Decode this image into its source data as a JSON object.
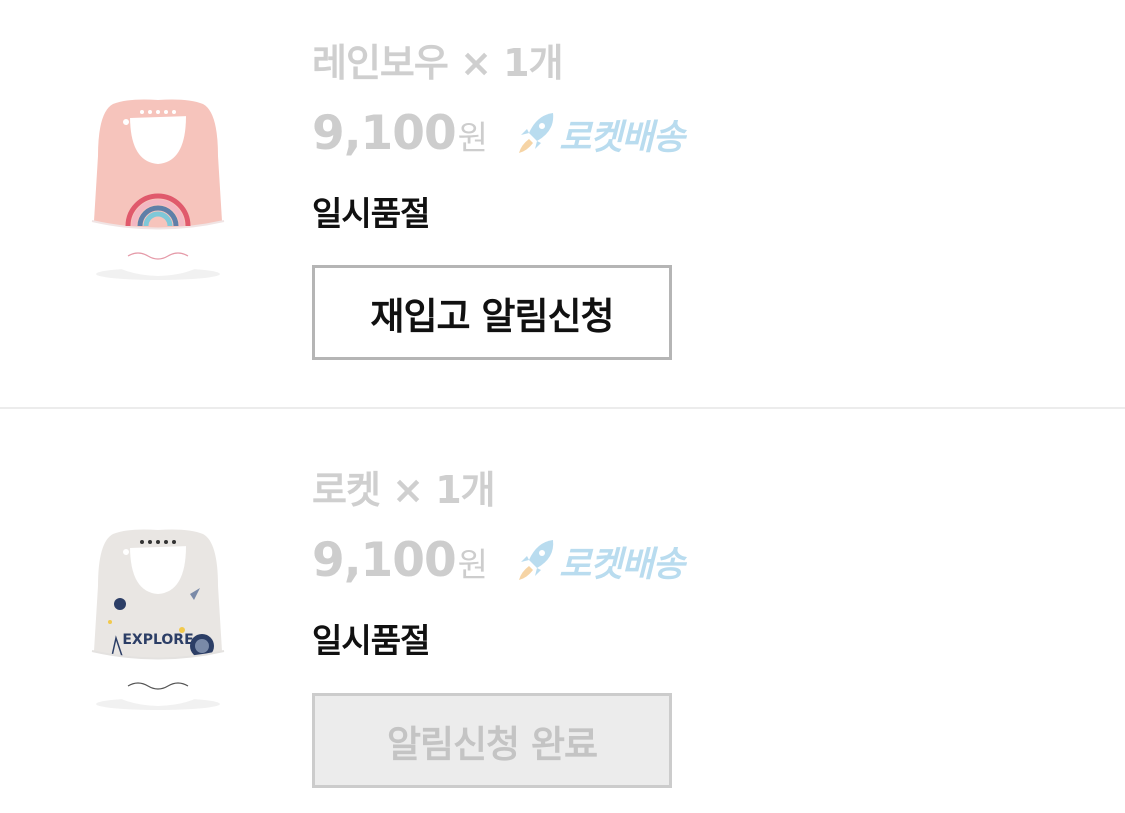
{
  "items": [
    {
      "title": "레인보우 × 1개",
      "price": "9,100",
      "currency": "원",
      "delivery_label": "로켓배송",
      "delivery_icon": "rocket-icon",
      "status": "일시품절",
      "button_label": "재입고 알림신청",
      "button_state": "active",
      "image": "rainbow-bib"
    },
    {
      "title": "로켓 × 1개",
      "price": "9,100",
      "currency": "원",
      "delivery_label": "로켓배송",
      "delivery_icon": "rocket-icon",
      "status": "일시품절",
      "button_label": "알림신청 완료",
      "button_state": "completed",
      "image": "space-explore-bib",
      "image_text": "EXPLORE"
    }
  ],
  "colors": {
    "muted_text": "#cdcdcd",
    "rocket_blue": "#b9dcef",
    "rocket_orange": "#f6d4a5",
    "button_border": "#b5b5b5",
    "done_bg": "#ececec"
  }
}
